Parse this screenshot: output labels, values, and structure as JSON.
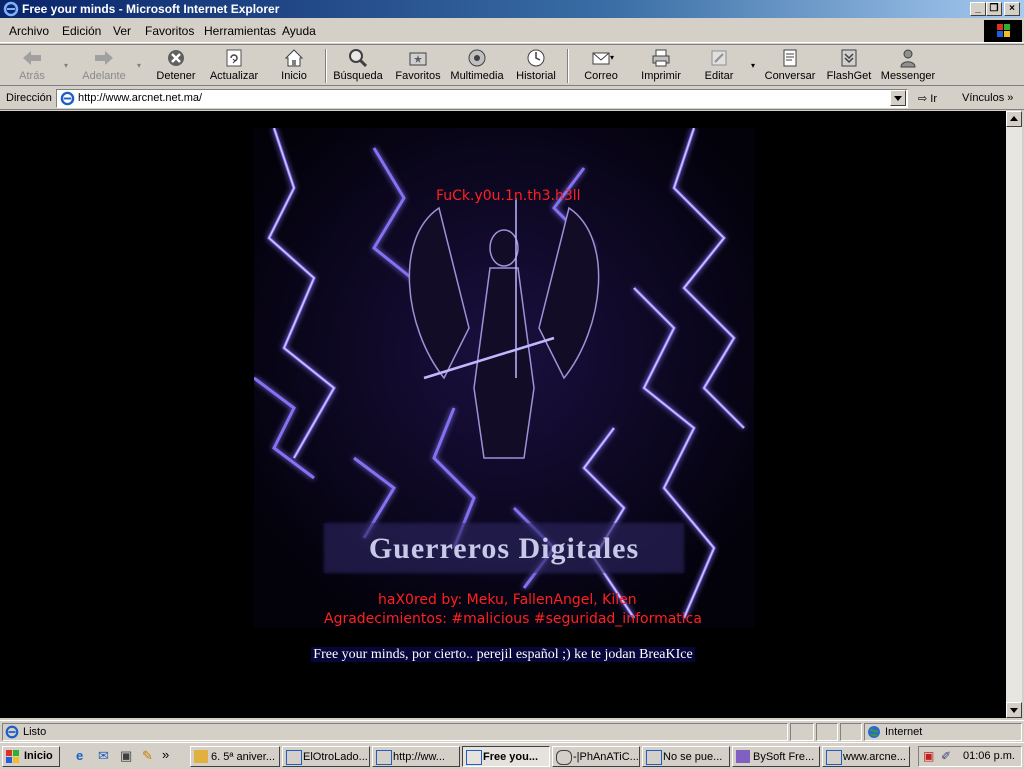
{
  "window": {
    "title": "Free your minds - Microsoft Internet Explorer",
    "buttons": [
      "_",
      "❐",
      "×"
    ]
  },
  "menu": [
    "Archivo",
    "Edición",
    "Ver",
    "Favoritos",
    "Herramientas",
    "Ayuda"
  ],
  "toolbar": {
    "back": "Atrás",
    "forward": "Adelante",
    "stop": "Detener",
    "refresh": "Actualizar",
    "home": "Inicio",
    "search": "Búsqueda",
    "favorites": "Favoritos",
    "media": "Multimedia",
    "history": "Historial",
    "mail": "Correo",
    "print": "Imprimir",
    "edit": "Editar",
    "discuss": "Conversar",
    "flashget": "FlashGet",
    "messenger": "Messenger"
  },
  "address": {
    "label": "Dirección",
    "url": "http://www.arcnet.net.ma/",
    "go": "Ir",
    "links": "Vínculos"
  },
  "page": {
    "top_text": "FuCk.y0u.1n.th3.h3ll",
    "logo_text": "Guerreros Digitales",
    "credits": "haX0red by: Meku, FallenAngel, Kilen",
    "thanks": "Agradecimientos: #malicious #seguridad_informatica",
    "message": "Free your minds, por cierto.. perejil español ;) ke te jodan BreaKIce"
  },
  "status": {
    "text": "Listo",
    "zone": "Internet"
  },
  "taskbar": {
    "start": "Inicio",
    "tasks": [
      "6. 5ª aniver...",
      "ElOtroLado...",
      "http://ww...",
      "Free you...",
      "-|PhAnATiC...",
      "No se pue...",
      "BySoft Fre...",
      "www.arcne..."
    ],
    "clock": "01:06 p.m."
  },
  "colors": {
    "deface_red": "#ff2020",
    "lightning": "#b8a8ff",
    "titlebar": "#0a246a"
  }
}
